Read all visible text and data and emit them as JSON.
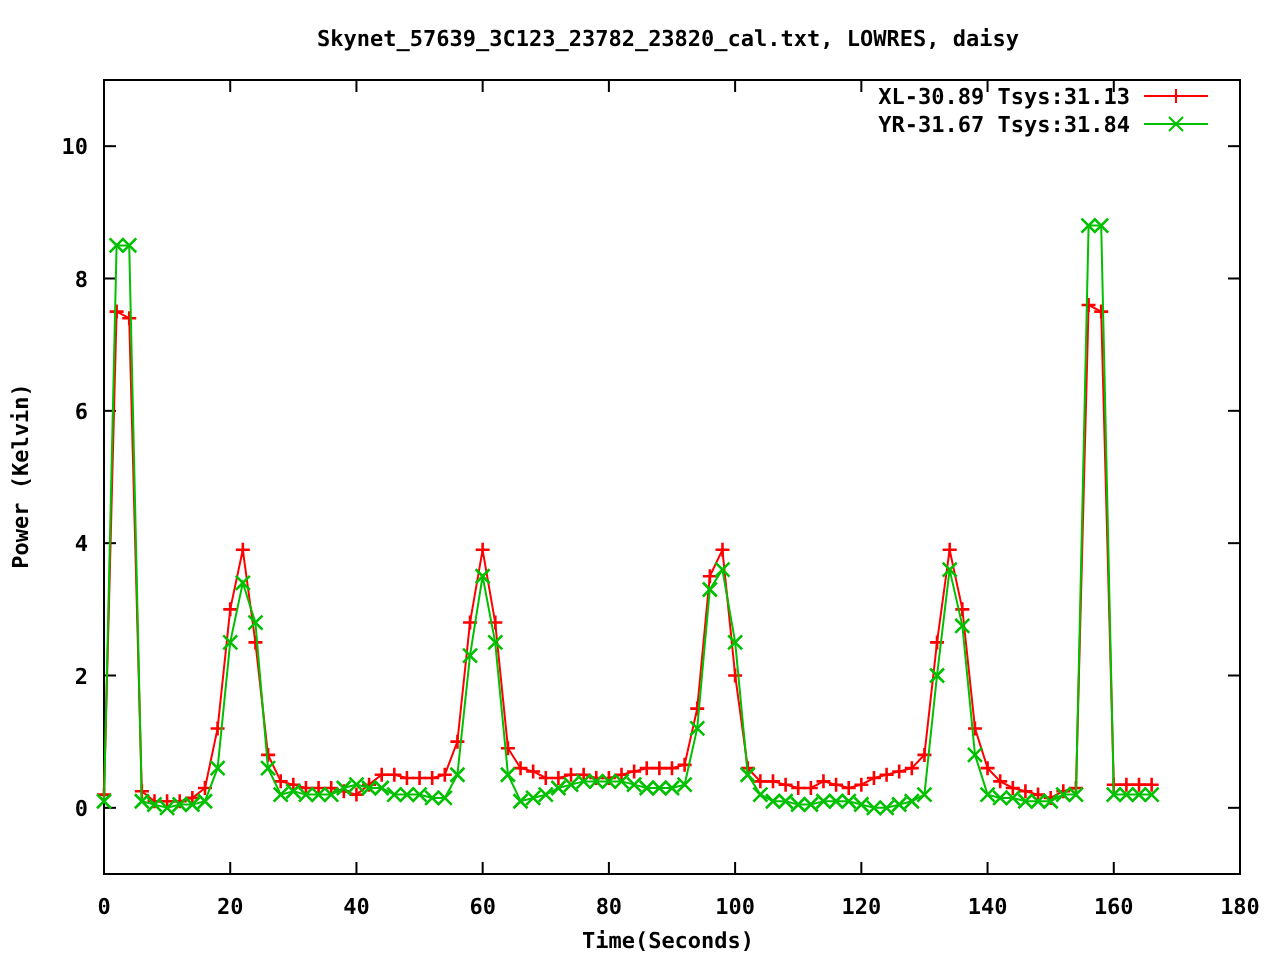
{
  "chart_data": {
    "type": "line",
    "title": "Skynet_57639_3C123_23782_23820_cal.txt, LOWRES, daisy",
    "xlabel": "Time(Seconds)",
    "ylabel": "Power (Kelvin)",
    "xlim": [
      0,
      180
    ],
    "ylim": [
      -1,
      11
    ],
    "xticks": [
      0,
      20,
      40,
      60,
      80,
      100,
      120,
      140,
      160,
      180
    ],
    "yticks": [
      0,
      2,
      4,
      6,
      8,
      10
    ],
    "legend": true,
    "x": [
      0,
      2,
      4,
      6,
      8,
      10,
      12,
      14,
      16,
      18,
      20,
      22,
      24,
      26,
      28,
      30,
      32,
      34,
      36,
      38,
      40,
      42,
      44,
      46,
      48,
      50,
      52,
      54,
      56,
      58,
      60,
      62,
      64,
      66,
      68,
      70,
      72,
      74,
      76,
      78,
      80,
      82,
      84,
      86,
      88,
      90,
      92,
      94,
      96,
      98,
      100,
      102,
      104,
      106,
      108,
      110,
      112,
      114,
      116,
      118,
      120,
      122,
      124,
      126,
      128,
      130,
      132,
      134,
      136,
      138,
      140,
      142,
      144,
      146,
      148,
      150,
      152,
      154,
      156,
      158,
      160,
      162,
      164,
      166
    ],
    "series": [
      {
        "name": "XL-30.89 Tsys:31.13",
        "color": "#ff0000",
        "marker": "plus",
        "values": [
          0.2,
          7.5,
          7.4,
          0.25,
          0.1,
          0.1,
          0.1,
          0.15,
          0.3,
          1.2,
          3.0,
          3.9,
          2.5,
          0.8,
          0.4,
          0.35,
          0.3,
          0.3,
          0.3,
          0.25,
          0.2,
          0.35,
          0.5,
          0.5,
          0.45,
          0.45,
          0.45,
          0.5,
          1.0,
          2.8,
          3.9,
          2.8,
          0.9,
          0.6,
          0.55,
          0.45,
          0.45,
          0.5,
          0.5,
          0.45,
          0.45,
          0.5,
          0.55,
          0.6,
          0.6,
          0.6,
          0.65,
          1.5,
          3.5,
          3.9,
          2.0,
          0.6,
          0.4,
          0.4,
          0.35,
          0.3,
          0.3,
          0.4,
          0.35,
          0.3,
          0.35,
          0.45,
          0.5,
          0.55,
          0.6,
          0.8,
          2.5,
          3.9,
          3.0,
          1.2,
          0.6,
          0.4,
          0.3,
          0.25,
          0.2,
          0.15,
          0.25,
          0.3,
          7.6,
          7.5,
          0.35,
          0.35,
          0.35,
          0.35
        ]
      },
      {
        "name": "YR-31.67 Tsys:31.84",
        "color": "#00c000",
        "marker": "cross",
        "values": [
          0.1,
          8.5,
          8.5,
          0.1,
          0.05,
          0.0,
          0.05,
          0.05,
          0.1,
          0.6,
          2.5,
          3.4,
          2.8,
          0.6,
          0.2,
          0.25,
          0.2,
          0.2,
          0.2,
          0.3,
          0.35,
          0.3,
          0.3,
          0.2,
          0.2,
          0.2,
          0.15,
          0.15,
          0.5,
          2.3,
          3.5,
          2.5,
          0.5,
          0.1,
          0.15,
          0.2,
          0.3,
          0.35,
          0.4,
          0.4,
          0.4,
          0.4,
          0.35,
          0.3,
          0.3,
          0.3,
          0.35,
          1.2,
          3.3,
          3.6,
          2.5,
          0.5,
          0.2,
          0.1,
          0.1,
          0.05,
          0.05,
          0.1,
          0.1,
          0.1,
          0.05,
          0.0,
          0.0,
          0.05,
          0.1,
          0.2,
          2.0,
          3.6,
          2.75,
          0.8,
          0.2,
          0.15,
          0.15,
          0.1,
          0.1,
          0.1,
          0.2,
          0.2,
          8.8,
          8.8,
          0.2,
          0.2,
          0.2,
          0.2
        ]
      }
    ]
  }
}
